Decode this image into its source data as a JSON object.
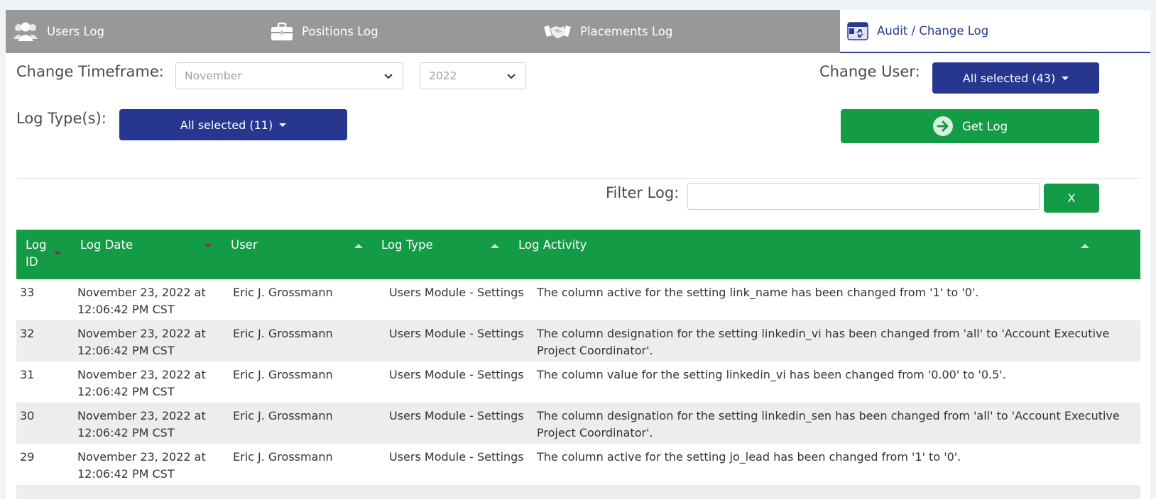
{
  "tabs": [
    {
      "label": "Users Log",
      "icon": "users-icon"
    },
    {
      "label": "Positions Log",
      "icon": "briefcase-icon"
    },
    {
      "label": "Placements Log",
      "icon": "handshake-icon"
    },
    {
      "label": "Audit / Change Log",
      "icon": "audit-icon",
      "active": true
    }
  ],
  "controls": {
    "timeframe_label": "Change Timeframe:",
    "month_value": "November",
    "year_value": "2022",
    "user_label": "Change User:",
    "user_select": "All selected (43)",
    "logtype_label": "Log Type(s):",
    "logtype_select": "All selected (11)",
    "get_log_label": "Get Log",
    "filter_label": "Filter Log:",
    "filter_value": "",
    "clear_label": "X"
  },
  "colors": {
    "primary_blue": "#27378f",
    "accent_green": "#139b45",
    "tab_bar_gray": "#989898"
  },
  "table": {
    "columns": [
      "Log ID",
      "Log Date",
      "User",
      "Log Type",
      "Log Activity"
    ],
    "col_id_line1": "Log",
    "col_id_line2": "ID",
    "rows": [
      {
        "id": "33",
        "date1": "November 23, 2022 at",
        "date2": "12:06:42 PM CST",
        "user": "Eric J. Grossmann",
        "type": "Users Module - Settings",
        "activity": "The column active for the setting link_name has been changed from '1' to '0'."
      },
      {
        "id": "32",
        "date1": "November 23, 2022 at",
        "date2": "12:06:42 PM CST",
        "user": "Eric J. Grossmann",
        "type": "Users Module - Settings",
        "activity": "The column designation for the setting linkedin_vi has been changed from 'all' to 'Account Executive Project Coordinator'."
      },
      {
        "id": "31",
        "date1": "November 23, 2022 at",
        "date2": "12:06:42 PM CST",
        "user": "Eric J. Grossmann",
        "type": "Users Module - Settings",
        "activity": "The column value for the setting linkedin_vi has been changed from '0.00' to '0.5'."
      },
      {
        "id": "30",
        "date1": "November 23, 2022 at",
        "date2": "12:06:42 PM CST",
        "user": "Eric J. Grossmann",
        "type": "Users Module - Settings",
        "activity": "The column designation for the setting linkedin_sen has been changed from 'all' to 'Account Executive Project Coordinator'."
      },
      {
        "id": "29",
        "date1": "November 23, 2022 at",
        "date2": "12:06:42 PM CST",
        "user": "Eric J. Grossmann",
        "type": "Users Module - Settings",
        "activity": "The column active for the setting jo_lead has been changed from '1' to '0'."
      }
    ]
  }
}
